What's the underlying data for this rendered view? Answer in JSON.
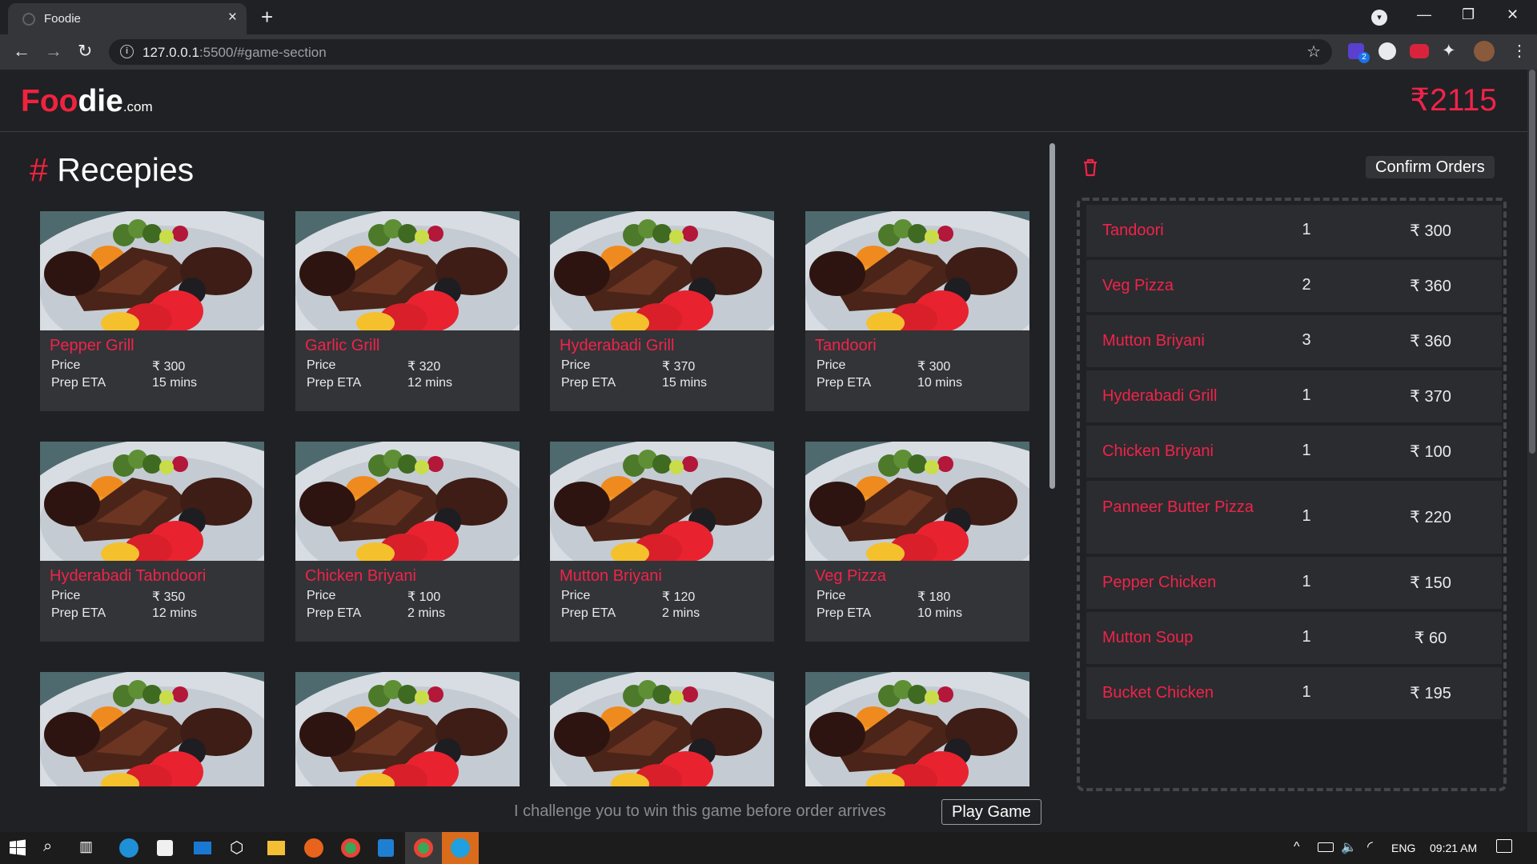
{
  "browser": {
    "tab_title": "Foodie",
    "tab_close": "×",
    "new_tab": "+",
    "url_host": "127.0.0.1",
    "url_rest": ":5500/#game-section",
    "extension_badge": "2"
  },
  "header": {
    "logo_part1": "Foo",
    "logo_part2": "die",
    "logo_suffix": ".com",
    "total": "₹2115"
  },
  "section": {
    "hash": "#",
    "title": "Recepies"
  },
  "card_labels": {
    "price": "Price",
    "eta": "Prep ETA"
  },
  "recipes": [
    {
      "name": "Pepper Grill",
      "price": "₹ 300",
      "eta": "15 mins"
    },
    {
      "name": "Garlic Grill",
      "price": "₹ 320",
      "eta": "12 mins"
    },
    {
      "name": "Hyderabadi Grill",
      "price": "₹ 370",
      "eta": "15 mins"
    },
    {
      "name": "Tandoori",
      "price": "₹ 300",
      "eta": "10 mins"
    },
    {
      "name": "Hyderabadi Tabndoori",
      "price": "₹ 350",
      "eta": "12 mins"
    },
    {
      "name": "Chicken Briyani",
      "price": "₹ 100",
      "eta": "2 mins"
    },
    {
      "name": "Mutton Briyani",
      "price": "₹ 120",
      "eta": "2 mins"
    },
    {
      "name": "Veg Pizza",
      "price": "₹ 180",
      "eta": "10 mins"
    }
  ],
  "orders_panel": {
    "confirm_label": "Confirm Orders",
    "items": [
      {
        "name": "Tandoori",
        "qty": "1",
        "price": "₹ 300"
      },
      {
        "name": "Veg Pizza",
        "qty": "2",
        "price": "₹ 360"
      },
      {
        "name": "Mutton Briyani",
        "qty": "3",
        "price": "₹ 360"
      },
      {
        "name": "Hyderabadi Grill",
        "qty": "1",
        "price": "₹ 370"
      },
      {
        "name": "Chicken Briyani",
        "qty": "1",
        "price": "₹ 100"
      },
      {
        "name": "Panneer Butter Pizza",
        "qty": "1",
        "price": "₹ 220"
      },
      {
        "name": "Pepper Chicken",
        "qty": "1",
        "price": "₹ 150"
      },
      {
        "name": "Mutton Soup",
        "qty": "1",
        "price": "₹ 60"
      },
      {
        "name": "Bucket Chicken",
        "qty": "1",
        "price": "₹ 195"
      }
    ]
  },
  "game": {
    "challenge_text": "I challenge you to win this game before order arrives",
    "play_label": "Play Game"
  },
  "taskbar": {
    "lang": "ENG",
    "time": "09:21 AM"
  },
  "colors": {
    "accent": "#f0234a",
    "background": "#202124",
    "card": "#333437"
  }
}
